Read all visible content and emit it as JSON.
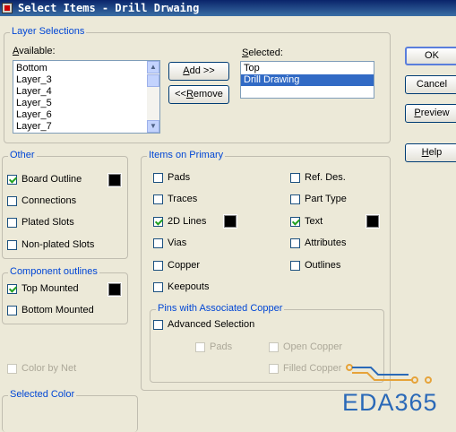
{
  "window": {
    "title": "Select Items - Drill Drwaing"
  },
  "layer_selections": {
    "group_label": "Layer Selections",
    "available_label": "Available:",
    "available_items": [
      "Bottom",
      "Layer_3",
      "Layer_4",
      "Layer_5",
      "Layer_6",
      "Layer_7"
    ],
    "selected_label": "Selected:",
    "selected_items": [
      "Top",
      "Drill Drawing"
    ],
    "selected_highlight_index": 1,
    "add_button": "Add >>",
    "remove_button": "<<Remove"
  },
  "buttons": {
    "ok": "OK",
    "cancel": "Cancel",
    "preview": "Preview",
    "help": "Help"
  },
  "other": {
    "group_label": "Other",
    "items": [
      {
        "label": "Board Outline",
        "checked": true
      },
      {
        "label": "Connections",
        "checked": false
      },
      {
        "label": "Plated Slots",
        "checked": false
      },
      {
        "label": "Non-plated Slots",
        "checked": false
      }
    ]
  },
  "component_outlines": {
    "group_label": "Component outlines",
    "items": [
      {
        "label": "Top Mounted",
        "checked": true
      },
      {
        "label": "Bottom Mounted",
        "checked": false
      }
    ]
  },
  "color_by_net": {
    "label": "Color by Net",
    "checked": false
  },
  "selected_color": {
    "label": "Selected Color"
  },
  "items_on_primary": {
    "group_label": "Items on Primary",
    "left": [
      {
        "label": "Pads",
        "checked": false
      },
      {
        "label": "Traces",
        "checked": false
      },
      {
        "label": "2D Lines",
        "checked": true
      },
      {
        "label": "Vias",
        "checked": false
      },
      {
        "label": "Copper",
        "checked": false
      },
      {
        "label": "Keepouts",
        "checked": false
      }
    ],
    "right": [
      {
        "label": "Ref. Des.",
        "checked": false
      },
      {
        "label": "Part Type",
        "checked": false
      },
      {
        "label": "Text",
        "checked": true
      },
      {
        "label": "Attributes",
        "checked": false
      },
      {
        "label": "Outlines",
        "checked": false
      }
    ]
  },
  "pins_with_copper": {
    "group_label": "Pins with Associated Copper",
    "advanced": {
      "label": "Advanced Selection",
      "checked": false
    },
    "pads": {
      "label": "Pads",
      "checked": false
    },
    "open_copper": {
      "label": "Open Copper",
      "checked": false
    },
    "filled_copper": {
      "label": "Filled Copper",
      "checked": false
    }
  },
  "watermark": {
    "text": "EDA365"
  },
  "colors": {
    "accent": "#0046d5",
    "swatch": "#000000",
    "selection": "#316ac5"
  }
}
